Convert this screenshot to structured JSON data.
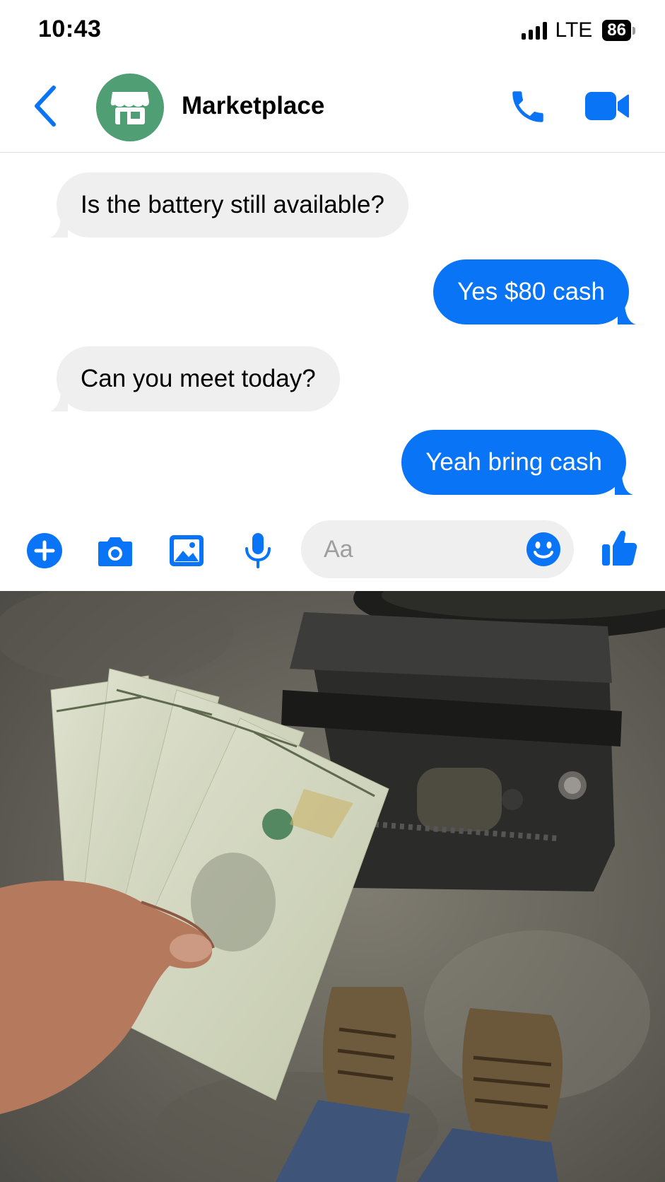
{
  "status_bar": {
    "time": "10:43",
    "network": "LTE",
    "battery": "86"
  },
  "header": {
    "title": "Marketplace",
    "avatar_icon": "store-icon",
    "call_icon": "phone-icon",
    "video_icon": "video-camera-icon"
  },
  "messages": [
    {
      "direction": "incoming",
      "text": "Is the battery still available?"
    },
    {
      "direction": "outgoing",
      "text": "Yes $80 cash"
    },
    {
      "direction": "incoming",
      "text": "Can you meet today?"
    },
    {
      "direction": "outgoing",
      "text": "Yeah bring cash"
    }
  ],
  "composer": {
    "placeholder": "Aa",
    "icons": [
      "plus-icon",
      "camera-icon",
      "gallery-icon",
      "microphone-icon",
      "emoji-icon",
      "thumbs-up-icon"
    ]
  },
  "photo": {
    "subject": "cash and car battery on garage floor"
  },
  "colors": {
    "accent": "#0a74f7",
    "incoming_bubble": "#efefef",
    "avatar": "#4f9e74"
  }
}
